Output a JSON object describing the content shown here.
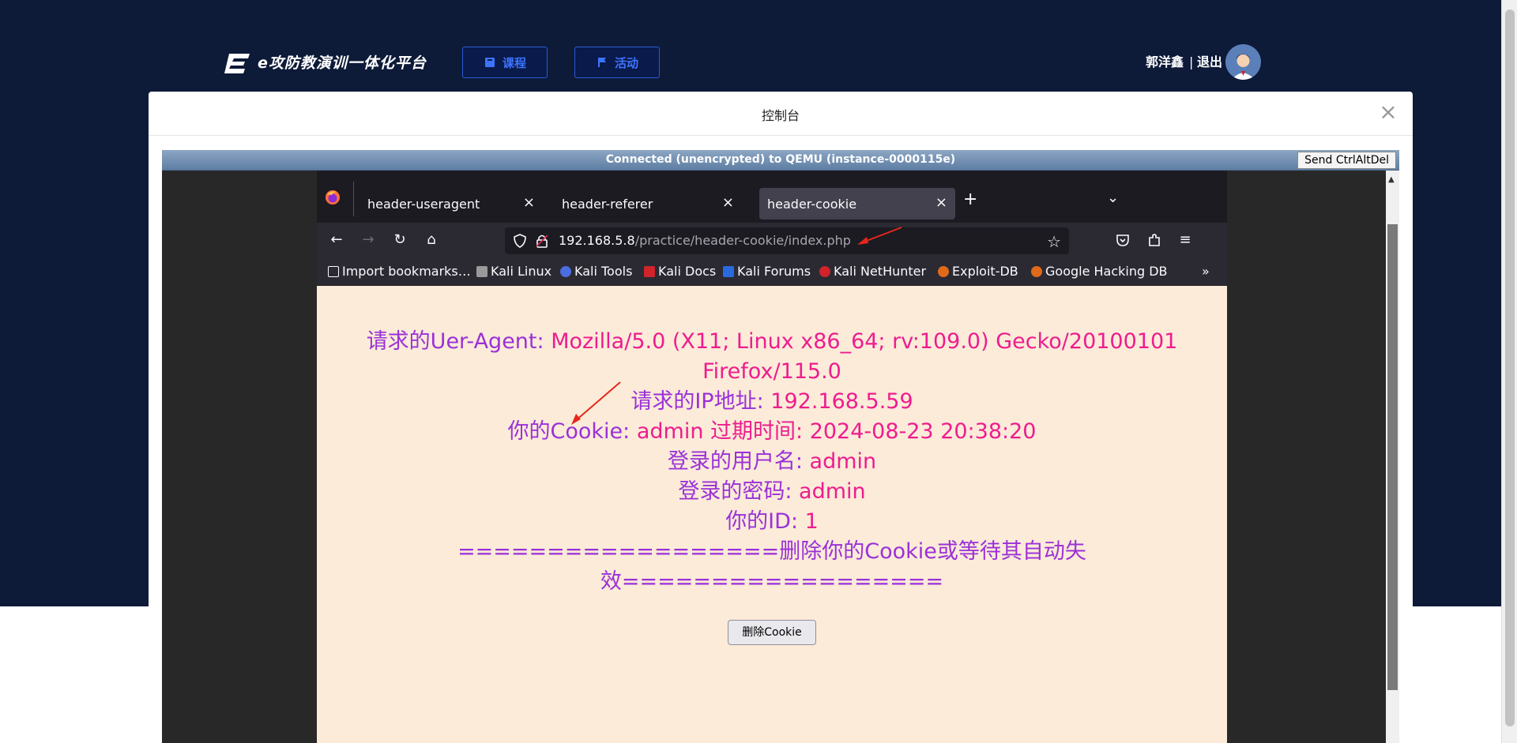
{
  "site": {
    "title": "e攻防教演训一体化平台",
    "nav": {
      "courses": "课程",
      "activity": "活动"
    },
    "user": {
      "name": "郭洋鑫",
      "separator": "|",
      "logout": "退出"
    }
  },
  "modal": {
    "title": "控制台",
    "close": "×"
  },
  "vnc": {
    "status": "Connected (unencrypted) to QEMU (instance-0000115e)",
    "send_cad": "Send CtrlAltDel"
  },
  "browser": {
    "tabs": [
      {
        "label": "header-useragent",
        "active": false
      },
      {
        "label": "header-referer",
        "active": false
      },
      {
        "label": "header-cookie",
        "active": true
      }
    ],
    "url_host": "192.168.5.8",
    "url_path": "/practice/header-cookie/index.php",
    "bookmarks": [
      {
        "label": "Import bookmarks…",
        "icon": "import-icon",
        "color": "#fbfbfe"
      },
      {
        "label": "Kali Linux",
        "icon": "kali-dragon-icon",
        "color": "#bbbbbb"
      },
      {
        "label": "Kali Tools",
        "icon": "kali-tools-icon",
        "color": "#4a6ee0"
      },
      {
        "label": "Kali Docs",
        "icon": "kali-docs-icon",
        "color": "#d0232a"
      },
      {
        "label": "Kali Forums",
        "icon": "kali-forums-icon",
        "color": "#2a6adf"
      },
      {
        "label": "Kali NetHunter",
        "icon": "nethunter-icon",
        "color": "#d0232a"
      },
      {
        "label": "Exploit-DB",
        "icon": "exploitdb-icon",
        "color": "#e06a1a"
      },
      {
        "label": "Google Hacking DB",
        "icon": "ghdb-icon",
        "color": "#e06a1a"
      }
    ]
  },
  "page": {
    "ua_label": "请求的Uer-Agent: ",
    "ua_value_1": "Mozilla/5.0 (X11; Linux x86_64; rv:109.0) Gecko/20100101",
    "ua_value_2": "Firefox/115.0",
    "ip_label": "请求的IP地址: ",
    "ip_value": "192.168.5.59",
    "cookie_label": "你的Cookie: ",
    "cookie_value": "admin 过期时间: 2024-08-23 20:38:20",
    "user_label": "登录的用户名: ",
    "user_value": "admin",
    "pass_label": "登录的密码: ",
    "pass_value": "admin",
    "id_label": "你的ID: ",
    "id_value": "1",
    "notice_1": "==================删除你的Cookie或等待其自动失",
    "notice_2": "效==================",
    "delete_button": "删除Cookie"
  },
  "colors": {
    "label": "#9b30d9",
    "value": "#ee1c8f",
    "accent": "#2a5bd7"
  }
}
